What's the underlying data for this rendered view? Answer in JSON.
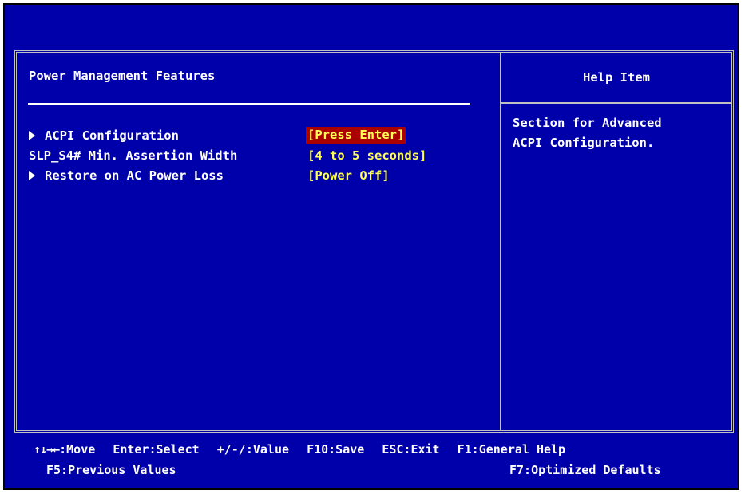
{
  "colors": {
    "background": "#0000aa",
    "text": "#ffffff",
    "value": "#ffff55",
    "selected_bg": "#aa0000",
    "frame": "#c0c0c0"
  },
  "left_panel": {
    "title": "Power Management Features",
    "items": [
      {
        "label": "ACPI Configuration",
        "value": "[Press Enter]",
        "has_submenu": true,
        "selected": true
      },
      {
        "label": "SLP_S4# Min. Assertion Width",
        "value": "[4 to 5 seconds]",
        "has_submenu": false,
        "selected": false
      },
      {
        "label": "Restore on AC Power Loss",
        "value": "[Power Off]",
        "has_submenu": true,
        "selected": false
      }
    ]
  },
  "help": {
    "title": "Help Item",
    "lines": [
      "Section for Advanced",
      "ACPI Configuration."
    ]
  },
  "footer": {
    "move_arrows": "↑↓→←",
    "move": ":Move",
    "select": "Enter:Select",
    "value": "+/-/:Value",
    "save": "F10:Save",
    "exit": "ESC:Exit",
    "help": "F1:General Help",
    "previous": "F5:Previous Values",
    "defaults": "F7:Optimized Defaults"
  }
}
